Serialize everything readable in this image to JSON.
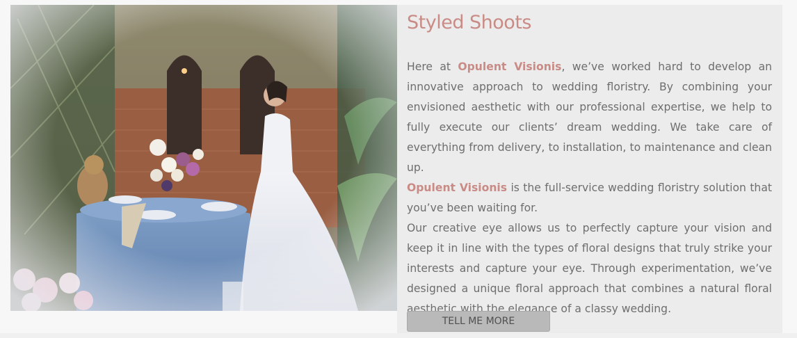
{
  "section": {
    "title": "Styled Shoots",
    "brand_name": "Opulent Visionis",
    "paragraph_1_after_intro": "Here at",
    "paragraph_1_rest": ", we’ve worked hard to develop an innovative approach to wedding floristry. By combining your envisioned aesthetic with our professional expertise, we help to fully execute our clients’ dream wedding. We take care of everything from delivery, to installation, to maintenance and clean up.",
    "paragraph_2_rest": " is the full-service wedding floristry solution that you’ve been waiting for.",
    "paragraph_3": "Our creative eye allows us to perfectly capture your vision and keep it in line with the types of floral designs that truly strike your interests and capture your eye. Through experimentation, we’ve designed a unique floral approach that combines a natural floral aesthetic with the elegance of a classy wedding.",
    "cta_label": "TELL ME MORE"
  }
}
